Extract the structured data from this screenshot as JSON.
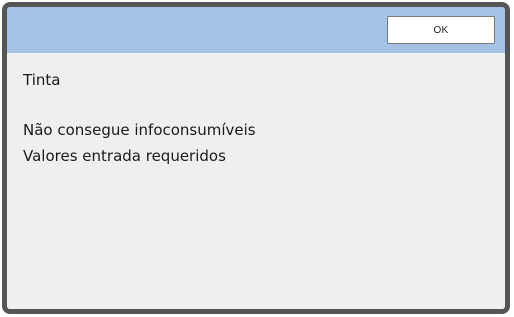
{
  "dialog": {
    "ok_label": "OK",
    "title": "Tinta",
    "messages": [
      "Não consegue infoconsumíveis",
      "Valores entrada requeridos"
    ]
  },
  "colors": {
    "header": "#a3c2e6",
    "border": "#555555",
    "body": "#efefef"
  }
}
